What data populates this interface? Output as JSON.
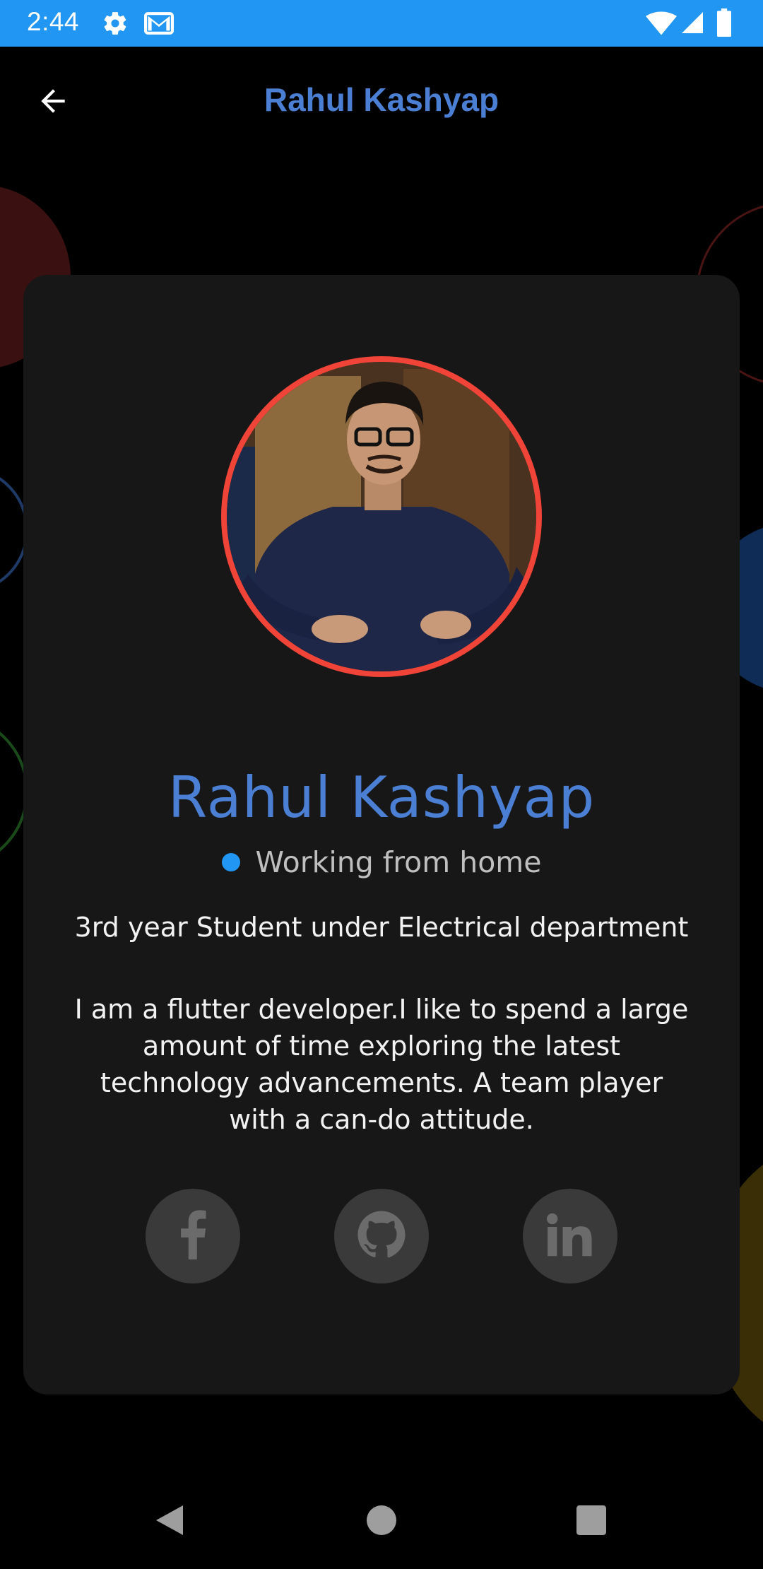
{
  "status_bar": {
    "time": "2:44",
    "icons": [
      "settings-icon",
      "gmail-icon",
      "wifi-icon",
      "signal-icon",
      "battery-icon"
    ],
    "bg_color": "#2196f3"
  },
  "app_bar": {
    "back_icon": "arrow-back-icon",
    "title": "Rahul Kashyap",
    "title_color": "#4a7fd4"
  },
  "profile": {
    "name": "Rahul Kashyap",
    "status": "Working from home",
    "status_color": "#2196f3",
    "role": "3rd year Student under Electrical department",
    "bio": "I am a flutter developer.I like to spend a large amount of time exploring the latest technology advancements. A team player with a can-do attitude.",
    "avatar_ring_color": "#f04438"
  },
  "social": [
    {
      "name": "facebook",
      "icon": "facebook-icon"
    },
    {
      "name": "github",
      "icon": "github-icon"
    },
    {
      "name": "linkedin",
      "icon": "linkedin-icon"
    }
  ],
  "nav_bar": {
    "buttons": [
      "back-triangle-icon",
      "home-circle-icon",
      "recents-square-icon"
    ]
  }
}
